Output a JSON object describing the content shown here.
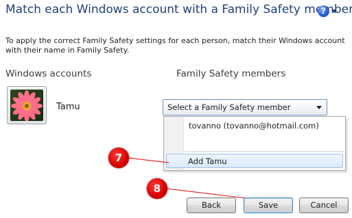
{
  "window": {
    "title": "Match each Windows account with a Family Safety member",
    "help_icon": "help-icon"
  },
  "instructions": "To apply the correct Family Safety settings for each person, match their Windows account with their name in Family Safety.",
  "columns": {
    "accounts_header": "Windows accounts",
    "members_header": "Family Safety members"
  },
  "account": {
    "name": "Tamu",
    "avatar": "flower-avatar"
  },
  "member_select": {
    "value": "Select a Family Safety member",
    "options": [
      "tovanno (tovanno@hotmail.com)",
      "Add Tamu"
    ],
    "highlighted": "Add Tamu"
  },
  "annotations": {
    "marker_7": "7",
    "marker_8": "8",
    "marker_color": "#e00000"
  },
  "buttons": {
    "back": "Back",
    "save": "Save",
    "cancel": "Cancel"
  }
}
